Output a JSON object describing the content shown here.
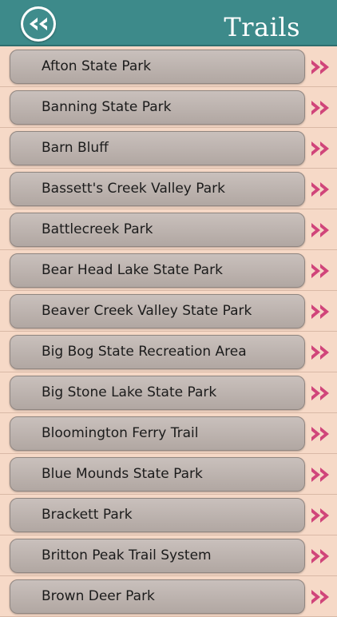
{
  "header": {
    "title": "Trails",
    "back_icon": "double-chevron-left-icon"
  },
  "colors": {
    "header": "#3d8a8a",
    "background": "#f6d9c7",
    "pill": "#b9afaa",
    "chevron": "#d0457a"
  },
  "items": [
    "Afton State Park",
    "Banning State Park",
    "Barn Bluff",
    "Bassett's Creek Valley Park",
    "Battlecreek Park",
    "Bear Head Lake State Park",
    "Beaver Creek Valley State Park",
    "Big Bog State Recreation Area",
    "Big Stone Lake State Park",
    "Bloomington Ferry Trail",
    "Blue Mounds State Park",
    "Brackett Park",
    "Britton Peak Trail System",
    "Brown Deer Park"
  ]
}
